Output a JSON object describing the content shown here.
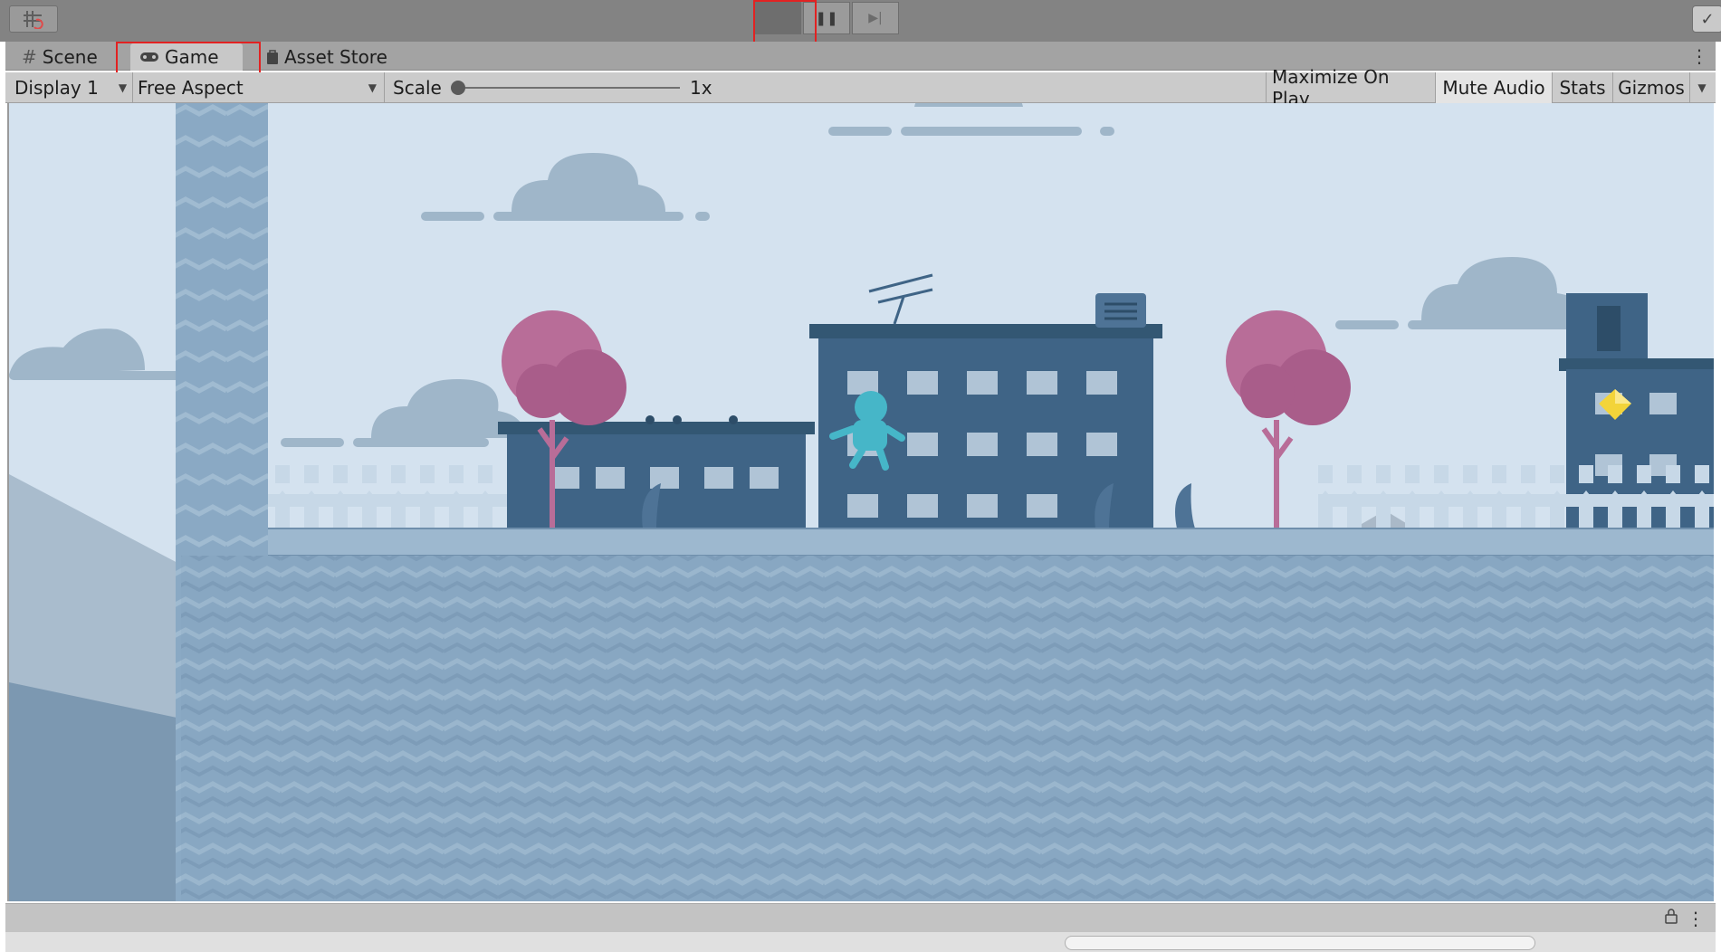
{
  "toolbar": {
    "left_tool_icon": "grid-snap-icon",
    "play_icon": "play-icon",
    "pause_icon": "pause-icon",
    "step_icon": "step-icon",
    "right_tool_icon": "check-icon",
    "pause_glyph": "❚❚",
    "step_glyph": "▶|",
    "check_glyph": "✓"
  },
  "tabs": {
    "scene": {
      "label": "Scene",
      "icon": "grid-icon",
      "glyph": "#"
    },
    "game": {
      "label": "Game",
      "icon": "gamepad-icon"
    },
    "asset_store": {
      "label": "Asset Store",
      "icon": "bag-icon"
    },
    "menu_glyph": "⋮"
  },
  "controls": {
    "display": "Display 1",
    "aspect": "Free Aspect",
    "scale_label": "Scale",
    "scale_value": "1x",
    "scale_fraction": 0.0,
    "maximize": "Maximize On Play",
    "mute": "Mute Audio",
    "stats": "Stats",
    "gizmos": "Gizmos"
  },
  "status": {
    "lock_icon": "lock-icon",
    "menu_glyph": "⋮",
    "lock_glyph": "🔒"
  },
  "colors": {
    "highlight": "#e22222",
    "sky": "#d2e1ee",
    "building": "#3f6486",
    "tree": "#b86d98",
    "ground": "#87a6c2",
    "player": "#46b6c8",
    "gem": "#f3d43a"
  }
}
